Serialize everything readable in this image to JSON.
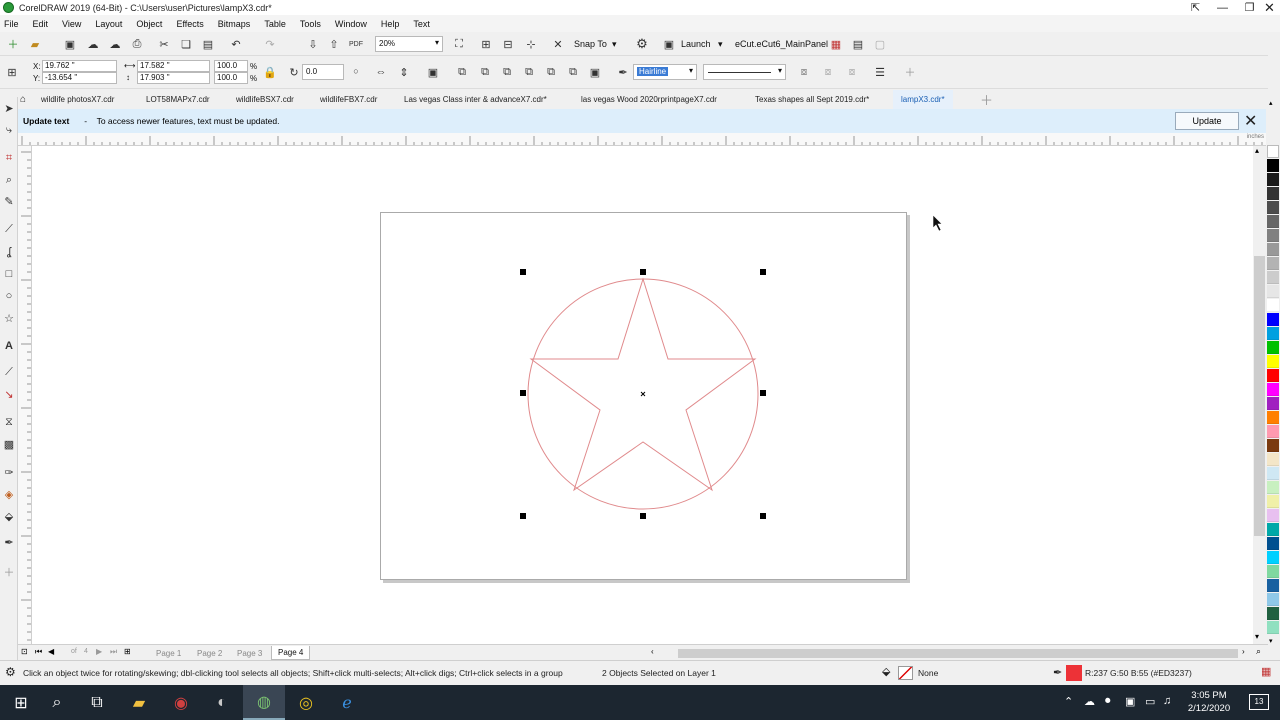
{
  "window": {
    "title": "CorelDRAW 2019 (64-Bit) - C:\\Users\\user\\Pictures\\lampX3.cdr*"
  },
  "menu": [
    "File",
    "Edit",
    "View",
    "Layout",
    "Object",
    "Effects",
    "Bitmaps",
    "Table",
    "Tools",
    "Window",
    "Help",
    "Text"
  ],
  "toolbar": {
    "zoom": "20%",
    "snap_to": "Snap To",
    "launch": "Launch",
    "macro": "eCut.eCut6_MainPanel"
  },
  "property_bar": {
    "x": "19.762 \"",
    "y": "-13.654 \"",
    "width": "17.582 \"",
    "height": "17.903 \"",
    "scale_x": "100.0",
    "scale_y": "100.0",
    "percent": "%",
    "x_label": "X:",
    "y_label": "Y:",
    "rotation": "0.0",
    "outline": "Hairline"
  },
  "tabs": [
    "wildlife photosX7.cdr",
    "LOT58MAPx7.cdr",
    "wildlifeBSX7.cdr",
    "wildlifeFBX7.cdr",
    "Las vegas Class inter & advanceX7.cdr*",
    "las vegas Wood 2020rprintpageX7.cdr",
    "Texas shapes all Sept 2019.cdr*",
    "lampX3.cdr*"
  ],
  "notice": {
    "title": "Update text",
    "message": "To access newer features, text must be updated.",
    "button": "Update"
  },
  "ruler_unit": "inches",
  "pages": {
    "labels": [
      "Page 1",
      "Page 2",
      "Page 3",
      "Page 4"
    ],
    "current": "Page 4",
    "of": "4",
    "of_label": "of"
  },
  "status": {
    "hint": "Click an object twice for rotating/skewing; dbl-clicking tool selects all objects; Shift+click multi-selects; Alt+click digs; Ctrl+click selects in a group",
    "selection": "2 Objects Selected on Layer 1",
    "fill": "None",
    "outline_color": "R:237 G:50 B:55 (#ED3237)"
  },
  "colors": {
    "outline": "#ED3237",
    "accent": "#1a5fb4"
  },
  "taskbar": {
    "time": "3:05 PM",
    "date": "2/12/2020",
    "notifications": "13"
  }
}
